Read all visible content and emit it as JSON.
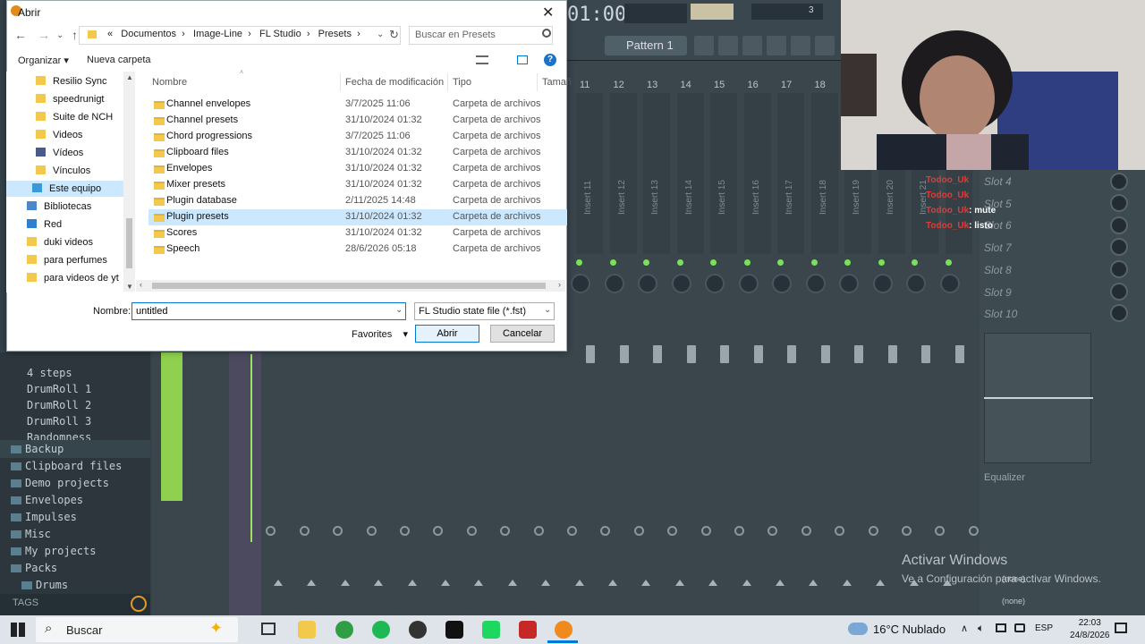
{
  "dialog": {
    "title": "Abrir",
    "close": "✕",
    "breadcrumbs": [
      "«",
      "Documentos",
      "Image-Line",
      "FL Studio",
      "Presets"
    ],
    "search_placeholder": "Buscar en Presets",
    "organize": "Organizar ▾",
    "new_folder": "Nueva carpeta",
    "help": "?",
    "nav_items": [
      "Resilio Sync",
      "speedrunigt",
      "Suite de NCH",
      "Videos",
      "Vídeos",
      "Vínculos",
      "Este equipo",
      "Bibliotecas",
      "Red",
      "duki videos",
      "para perfumes",
      "para videos de yt"
    ],
    "columns": {
      "name": "Nombre",
      "date": "Fecha de modificación",
      "type": "Tipo",
      "size": "Tamañ"
    },
    "files": [
      {
        "name": "Channel envelopes",
        "date": "3/7/2025 11:06",
        "type": "Carpeta de archivos"
      },
      {
        "name": "Channel presets",
        "date": "31/10/2024 01:32",
        "type": "Carpeta de archivos"
      },
      {
        "name": "Chord progressions",
        "date": "3/7/2025 11:06",
        "type": "Carpeta de archivos"
      },
      {
        "name": "Clipboard files",
        "date": "31/10/2024 01:32",
        "type": "Carpeta de archivos"
      },
      {
        "name": "Envelopes",
        "date": "31/10/2024 01:32",
        "type": "Carpeta de archivos"
      },
      {
        "name": "Mixer presets",
        "date": "31/10/2024 01:32",
        "type": "Carpeta de archivos"
      },
      {
        "name": "Plugin database",
        "date": "2/11/2025 14:48",
        "type": "Carpeta de archivos"
      },
      {
        "name": "Plugin presets",
        "date": "31/10/2024 01:32",
        "type": "Carpeta de archivos"
      },
      {
        "name": "Scores",
        "date": "31/10/2024 01:32",
        "type": "Carpeta de archivos"
      },
      {
        "name": "Speech",
        "date": "28/6/2026 05:18",
        "type": "Carpeta de archivos"
      }
    ],
    "selected_file": "Plugin presets",
    "filename_label": "Nombre:",
    "filename_value": "untitled",
    "filetype": "FL Studio state file (*.fst)",
    "favorites": "Favorites",
    "open_button": "Abrir",
    "cancel_button": "Cancelar"
  },
  "fl": {
    "time": "01:00",
    "step_count": "3",
    "pattern": "Pattern 1",
    "track_numbers": [
      "11",
      "12",
      "13",
      "14",
      "15",
      "16",
      "17",
      "18"
    ],
    "insert_labels": [
      "Insert 11",
      "Insert 12",
      "Insert 13",
      "Insert 14",
      "Insert 15",
      "Insert 16",
      "Insert 17",
      "Insert 18",
      "Insert 19",
      "Insert 20",
      "Insert 21"
    ],
    "browser_items": [
      "4 steps",
      "DrumRoll 1",
      "DrumRoll 2",
      "DrumRoll 3",
      "Randomness"
    ],
    "browser_folders": [
      "Backup",
      "Clipboard files",
      "Demo projects",
      "Envelopes",
      "Impulses",
      "Misc",
      "My projects",
      "Packs"
    ],
    "browser_sub": "Drums",
    "tags": "TAGS",
    "slots": [
      "Slot 4",
      "Slot 5",
      "Slot 6",
      "Slot 7",
      "Slot 8",
      "Slot 9",
      "Slot 10"
    ],
    "equalizer": "Equalizer",
    "none1": "(none)",
    "none2": "(none)"
  },
  "chat": [
    {
      "user": "Todoo_Uk",
      "msg": ""
    },
    {
      "user": "Todoo_Uk",
      "msg": ""
    },
    {
      "user": "Todoo_Uk",
      "msg": ": mute"
    },
    {
      "user": "Todoo_Uk",
      "msg": ": listo"
    }
  ],
  "watermark": {
    "line1": "Activar Windows",
    "line2": "Ve a Configuración para activar Windows."
  },
  "taskbar": {
    "search": "Buscar",
    "weather": "16°C  Nublado",
    "lang": "ESP",
    "time": "22:03",
    "date": "24/8/2026"
  }
}
